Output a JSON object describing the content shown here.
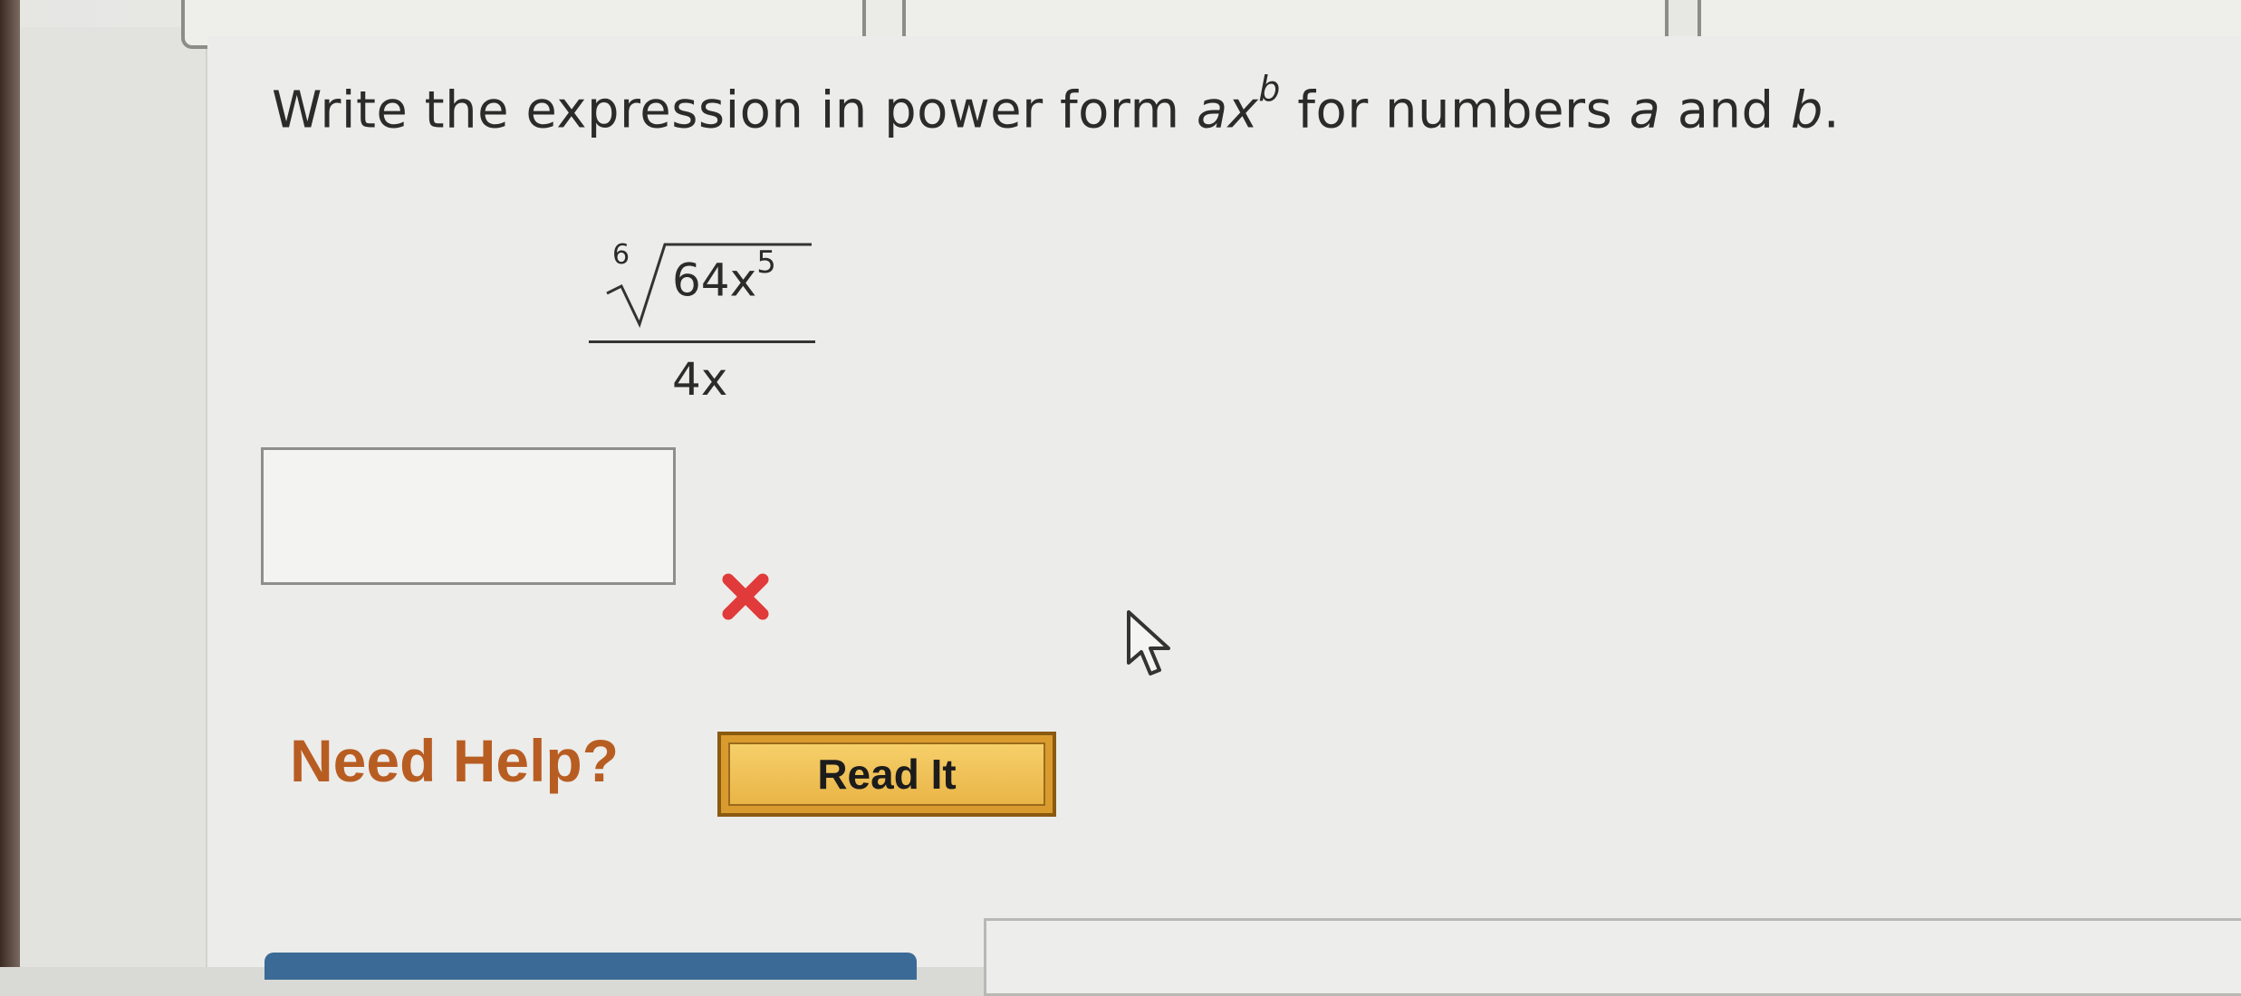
{
  "question": {
    "text_before": "Write the expression in power form ",
    "var_a": "a",
    "var_x": "x",
    "var_b_sup": "b",
    "text_middle": " for numbers ",
    "var_a2": "a",
    "text_and": " and ",
    "var_b": "b",
    "text_end": "."
  },
  "expression": {
    "root_index": "6",
    "radicand_base": "64x",
    "radicand_exponent": "5",
    "denominator": "4x"
  },
  "answer": {
    "value": "",
    "status": "incorrect",
    "status_color": "#e03a3a"
  },
  "help": {
    "label": "Need Help?",
    "read_it_label": "Read It"
  },
  "colors": {
    "help_label": "#b85d22",
    "read_button": "#e9b547"
  }
}
